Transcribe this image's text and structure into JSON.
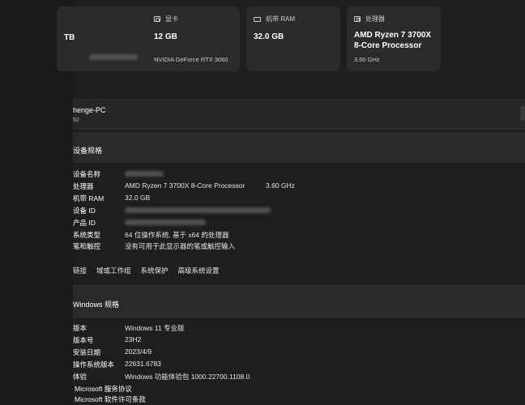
{
  "cards": [
    {
      "label": "",
      "value": "TB",
      "sub": ""
    },
    {
      "label": "显卡",
      "value": "12 GB",
      "sub": "NVIDIA GeForce RTX 3060",
      "icon": "gpu-icon"
    },
    {
      "label": "机带 RAM",
      "value": "32.0 GB",
      "sub": "",
      "icon": "ram-icon"
    },
    {
      "label": "处理器",
      "value": "AMD Ryzen 7 3700X 8-Core Processor",
      "sub": "3.60 GHz",
      "icon": "chip-icon"
    }
  ],
  "pc": {
    "name": "henge-PC",
    "sub": "52"
  },
  "device_specs": {
    "title": "设备规格",
    "rows": [
      {
        "k": "设备名称",
        "v": "",
        "v2": ""
      },
      {
        "k": "处理器",
        "v": "AMD Ryzen 7 3700X 8-Core Processor",
        "v2": "3.60 GHz"
      },
      {
        "k": "机带 RAM",
        "v": "32.0 GB",
        "v2": ""
      },
      {
        "k": "设备 ID",
        "v": "",
        "v2": ""
      },
      {
        "k": "产品 ID",
        "v": "",
        "v2": ""
      },
      {
        "k": "系统类型",
        "v": "64 位操作系统, 基于 x64 的处理器",
        "v2": ""
      },
      {
        "k": "笔和触控",
        "v": "没有可用于此显示器的笔或触控输入",
        "v2": ""
      }
    ]
  },
  "links": [
    "链接",
    "域或工作组",
    "系统保护",
    "高级系统设置"
  ],
  "windows_specs": {
    "title": "Windows 规格",
    "rows": [
      {
        "k": "版本",
        "v": "Windows 11 专业版"
      },
      {
        "k": "版本号",
        "v": "23H2"
      },
      {
        "k": "安装日期",
        "v": "2023/4/9"
      },
      {
        "k": "操作系统版本",
        "v": "22631.6783"
      },
      {
        "k": "体验",
        "v": "Windows 功能体验包 1000.22700.1108.0"
      }
    ],
    "agreements": [
      "Microsoft 服务协议",
      "Microsoft 软件许可条款"
    ]
  }
}
